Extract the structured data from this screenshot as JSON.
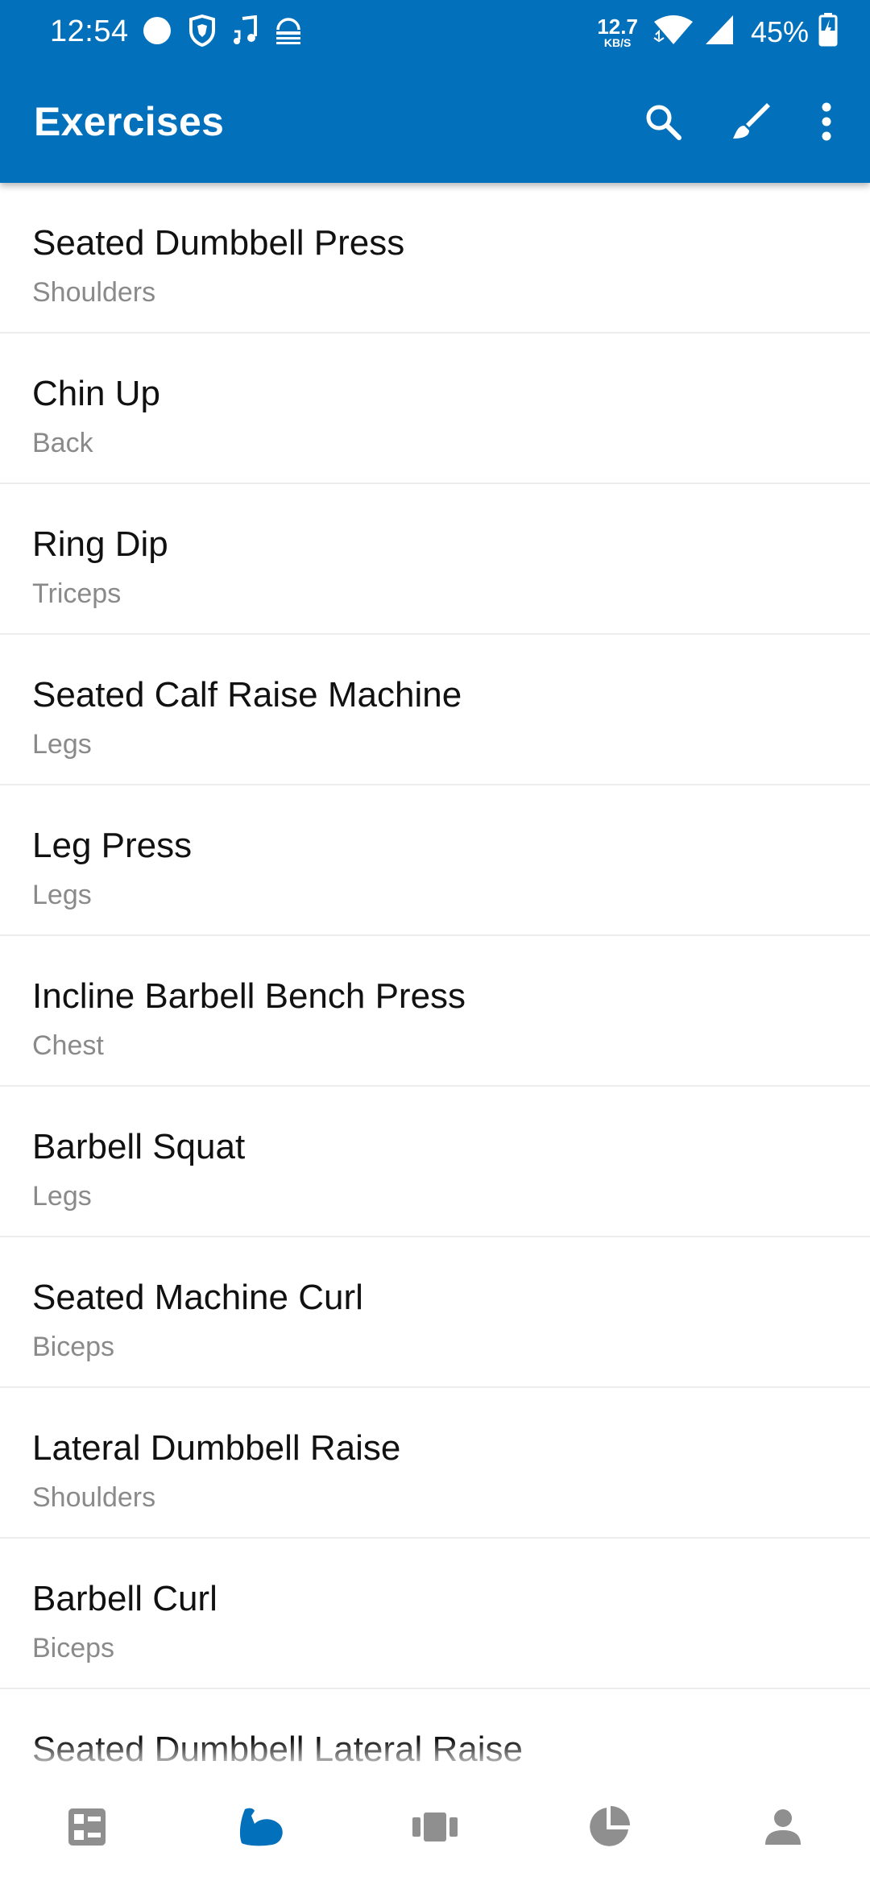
{
  "status_bar": {
    "time": "12:54",
    "net_speed_value": "12.7",
    "net_speed_unit": "KB/S",
    "battery_percent": "45%"
  },
  "app_bar": {
    "title": "Exercises",
    "actions": [
      "search-icon",
      "brush-icon",
      "more-vert-icon"
    ]
  },
  "exercises": [
    {
      "name": "Seated Dumbbell Press",
      "group": "Shoulders"
    },
    {
      "name": "Chin Up",
      "group": "Back"
    },
    {
      "name": "Ring Dip",
      "group": "Triceps"
    },
    {
      "name": "Seated Calf Raise Machine",
      "group": "Legs"
    },
    {
      "name": "Leg Press",
      "group": "Legs"
    },
    {
      "name": "Incline Barbell Bench Press",
      "group": "Chest"
    },
    {
      "name": "Barbell Squat",
      "group": "Legs"
    },
    {
      "name": "Seated Machine Curl",
      "group": "Biceps"
    },
    {
      "name": "Lateral Dumbbell Raise",
      "group": "Shoulders"
    },
    {
      "name": "Barbell Curl",
      "group": "Biceps"
    },
    {
      "name": "Seated Dumbbell Lateral Raise",
      "group": ""
    }
  ],
  "bottom_nav": {
    "items": [
      "dashboard-icon",
      "arm-flex-icon",
      "cards-icon",
      "pie-chart-icon",
      "person-icon"
    ],
    "active_index": 1
  },
  "colors": {
    "primary": "#0270BB",
    "nav_inactive": "#8F8F8F",
    "text_primary": "#111111",
    "text_secondary": "#8A8A8A"
  }
}
